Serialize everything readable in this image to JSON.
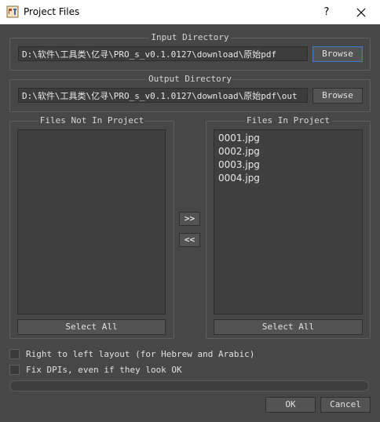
{
  "window": {
    "title": "Project Files",
    "help_label": "?",
    "close_icon": "close-icon",
    "app_icon": "scan-tailor-icon"
  },
  "input_directory": {
    "label": "Input Directory",
    "path": "D:\\软件\\工具类\\亿寻\\PRO_s_v0.1.0127\\download\\原始pdf",
    "browse_label": "Browse"
  },
  "output_directory": {
    "label": "Output Directory",
    "path": "D:\\软件\\工具类\\亿寻\\PRO_s_v0.1.0127\\download\\原始pdf\\out",
    "browse_label": "Browse"
  },
  "files_not_in_project": {
    "label": "Files Not In Project",
    "items": [],
    "select_all_label": "Select All"
  },
  "files_in_project": {
    "label": "Files In Project",
    "items": [
      "0001.jpg",
      "0002.jpg",
      "0003.jpg",
      "0004.jpg"
    ],
    "select_all_label": "Select All"
  },
  "transfer": {
    "add_label": ">>",
    "remove_label": "<<"
  },
  "options": {
    "rtl_label": "Right to left layout (for Hebrew and Arabic)",
    "rtl_checked": false,
    "fix_dpi_label": "Fix DPIs, even if they look OK",
    "fix_dpi_checked": false
  },
  "progress": {
    "value": 0
  },
  "footer": {
    "ok_label": "OK",
    "cancel_label": "Cancel"
  },
  "colors": {
    "background": "#474747",
    "focus_border": "#3c78c8",
    "titlebar": "#ffffff"
  }
}
